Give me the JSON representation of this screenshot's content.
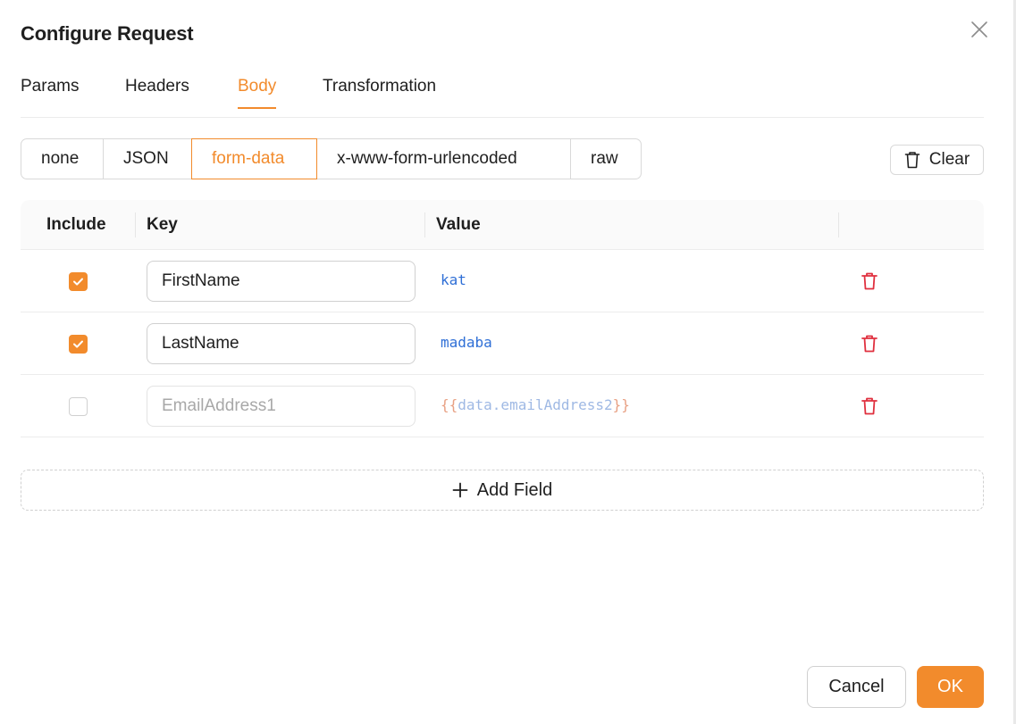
{
  "dialog": {
    "title": "Configure Request"
  },
  "tabs": [
    {
      "label": "Params",
      "active": false
    },
    {
      "label": "Headers",
      "active": false
    },
    {
      "label": "Body",
      "active": true
    },
    {
      "label": "Transformation",
      "active": false
    }
  ],
  "body_types": {
    "options": [
      "none",
      "JSON",
      "form-data",
      "x-www-form-urlencoded",
      "raw"
    ],
    "selected": "form-data"
  },
  "toolbar": {
    "clear_label": "Clear",
    "clear_icon": "trash-icon"
  },
  "table": {
    "columns": [
      "Include",
      "Key",
      "Value"
    ],
    "rows": [
      {
        "include": true,
        "key": "FirstName",
        "value": "kat",
        "disabled": false
      },
      {
        "include": true,
        "key": "LastName",
        "value": "madaba",
        "disabled": false
      },
      {
        "include": false,
        "key": "EmailAddress1",
        "value_brace_open": "{{",
        "value": "data.emailAddress2",
        "value_brace_close": "}}",
        "disabled": true
      }
    ]
  },
  "add_field": {
    "label": "Add Field",
    "icon": "plus-icon"
  },
  "footer": {
    "cancel_label": "Cancel",
    "ok_label": "OK"
  },
  "colors": {
    "accent": "#f28b2c",
    "value_text": "#2f6fd6",
    "delete_icon": "#e0303f",
    "template_brace": "#e8a184"
  }
}
